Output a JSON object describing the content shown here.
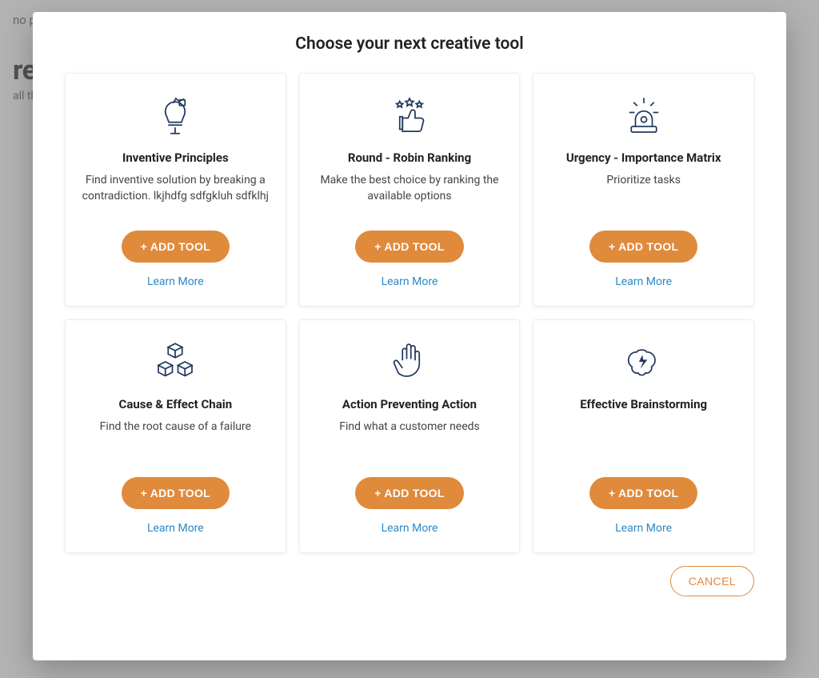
{
  "colors": {
    "accent": "#e08a3c",
    "link": "#2f88c5",
    "iconStroke": "#23395d"
  },
  "background": {
    "project_label": "no project",
    "heading_fragment": "rea",
    "sub_fragment": "all thi"
  },
  "dialog": {
    "title": "Choose your next creative tool",
    "add_label": "+ ADD TOOL",
    "learn_label": "Learn More",
    "cancel_label": "CANCEL",
    "cards": [
      {
        "icon": "lightbulb-puzzle-icon",
        "title": "Inventive Principles",
        "desc": "Find inventive solution by breaking a contradiction. lkjhdfg sdfgkluh sdfklhj"
      },
      {
        "icon": "thumbs-up-stars-icon",
        "title": "Round - Robin Ranking",
        "desc": "Make the best choice by ranking the available options"
      },
      {
        "icon": "siren-icon",
        "title": "Urgency - Importance Matrix",
        "desc": "Prioritize tasks"
      },
      {
        "icon": "cubes-icon",
        "title": "Cause & Effect Chain",
        "desc": "Find the root cause of a failure"
      },
      {
        "icon": "hand-stop-icon",
        "title": "Action Preventing Action",
        "desc": "Find what a customer needs"
      },
      {
        "icon": "brain-lightning-icon",
        "title": "Effective Brainstorming",
        "desc": ""
      }
    ]
  }
}
